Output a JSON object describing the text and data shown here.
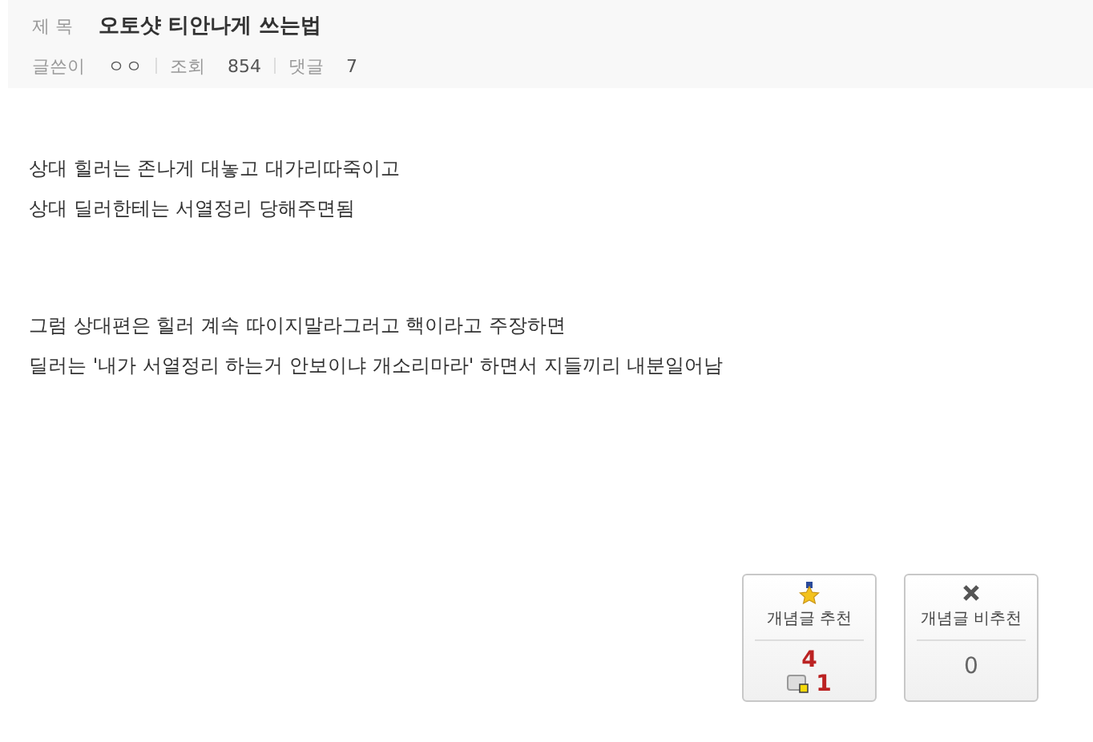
{
  "header": {
    "title_label": "제 목",
    "title": "오토샷 티안나게 쓰는법",
    "author_label": "글쓴이",
    "author": "ㅇㅇ",
    "views_label": "조회",
    "views": "854",
    "comments_label": "댓글",
    "comments": "7"
  },
  "body": {
    "paragraphs": [
      [
        "상대 힐러는 존나게 대놓고 대가리따죽이고",
        "상대 딜러한테는 서열정리 당해주면됨"
      ],
      [
        "그럼 상대편은 힐러 계속 따이지말라그러고 핵이라고 주장하면",
        "딜러는 '내가 서열정리 하는거 안보이냐 개소리마라' 하면서 지들끼리 내분일어남"
      ]
    ]
  },
  "votes": [
    {
      "kind": "up",
      "label": "개념글 추천",
      "count": "4",
      "mobile_count": "1"
    },
    {
      "kind": "down",
      "label": "개념글 비추천",
      "count": "0"
    }
  ]
}
